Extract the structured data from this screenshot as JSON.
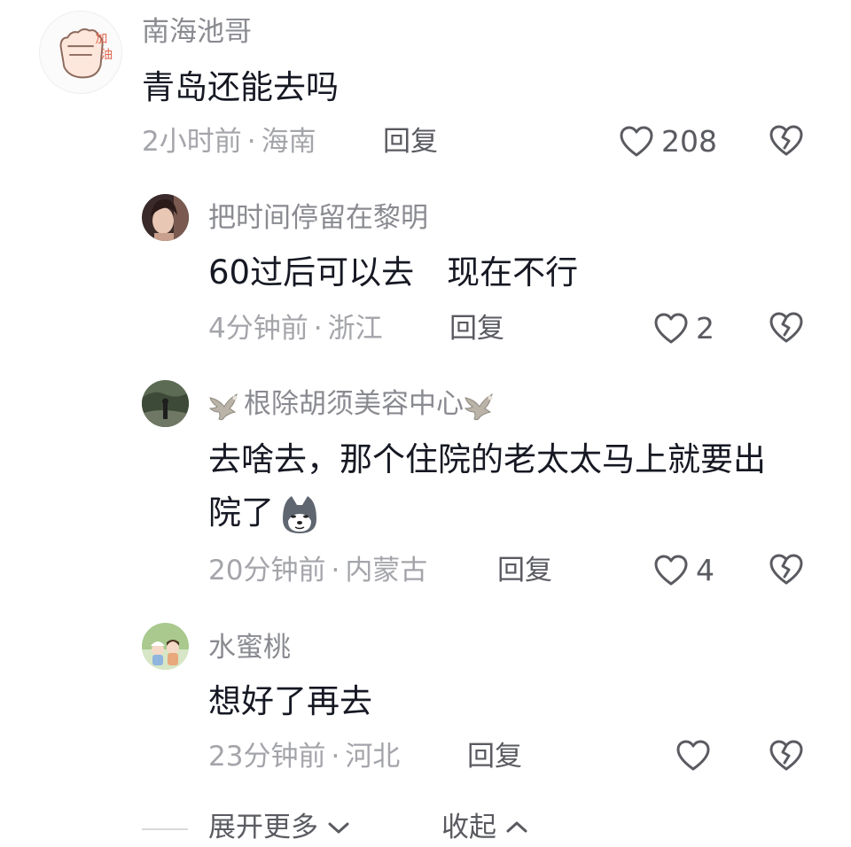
{
  "comments": [
    {
      "author": "南海池哥",
      "text": "青岛还能去吗",
      "time": "2小时前",
      "location": "海南",
      "reply": "回复",
      "likes": "208",
      "avatar_icon": "fist-avatar",
      "avatar_text": "加油"
    },
    {
      "author": "把时间停留在黎明",
      "text": "60过后可以去　现在不行",
      "time": "4分钟前",
      "location": "浙江",
      "reply": "回复",
      "likes": "2",
      "avatar_icon": "woman-photo-avatar"
    },
    {
      "author": "根除胡须美容中心",
      "text_line1": "去啥去，那个住院的老太太马上就要出",
      "text_line2": "院了",
      "time": "20分钟前",
      "location": "内蒙古",
      "reply": "回复",
      "likes": "4",
      "avatar_icon": "forest-photo-avatar",
      "decoration_icon": "eagle-emoji",
      "emoji_icon": "husky-emoji"
    },
    {
      "author": "水蜜桃",
      "text": "想好了再去",
      "time": "23分钟前",
      "location": "河北",
      "reply": "回复",
      "likes": "",
      "avatar_icon": "cartoon-kids-avatar"
    }
  ],
  "footer": {
    "expand_label": "展开更多",
    "collapse_label": "收起"
  },
  "colors": {
    "text_primary": "#161823",
    "text_secondary": "#8a8b91",
    "icon": "#5a5b61"
  }
}
